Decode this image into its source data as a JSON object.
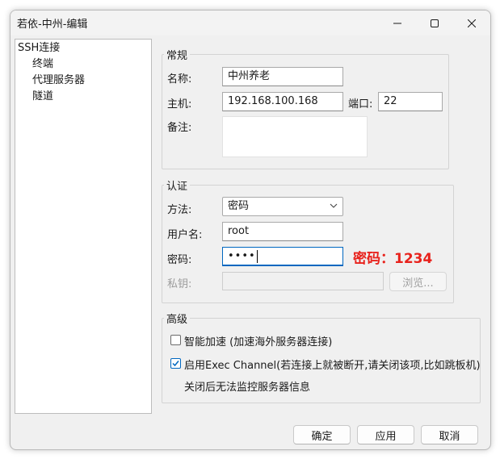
{
  "window": {
    "title": "若依-中州-编辑"
  },
  "tree": {
    "items": [
      "SSH连接",
      "终端",
      "代理服务器",
      "隧道"
    ]
  },
  "general": {
    "legend": "常规",
    "name_label": "名称:",
    "name_value": "中州养老",
    "host_label": "主机:",
    "host_value": "192.168.100.168",
    "port_label": "端口:",
    "port_value": "22",
    "note_label": "备注:",
    "note_value": ""
  },
  "auth": {
    "legend": "认证",
    "method_label": "方法:",
    "method_value": "密码",
    "user_label": "用户名:",
    "user_value": "root",
    "password_label": "密码:",
    "password_masked": "••••",
    "password_annotation": "密码：1234",
    "key_label": "私钥:",
    "key_value": "",
    "browse_label": "浏览..."
  },
  "advanced": {
    "legend": "高级",
    "smart_accel_label": "智能加速 (加速海外服务器连接)",
    "smart_accel_checked": false,
    "exec_channel_label": "启用Exec Channel(若连接上就被断开,请关闭该项,比如跳板机)",
    "exec_channel_checked": true,
    "exec_channel_note": "关闭后无法监控服务器信息"
  },
  "footer": {
    "ok_label": "确定",
    "apply_label": "应用",
    "cancel_label": "取消"
  },
  "colors": {
    "accent": "#0067c0",
    "annotation": "#e8221c"
  }
}
